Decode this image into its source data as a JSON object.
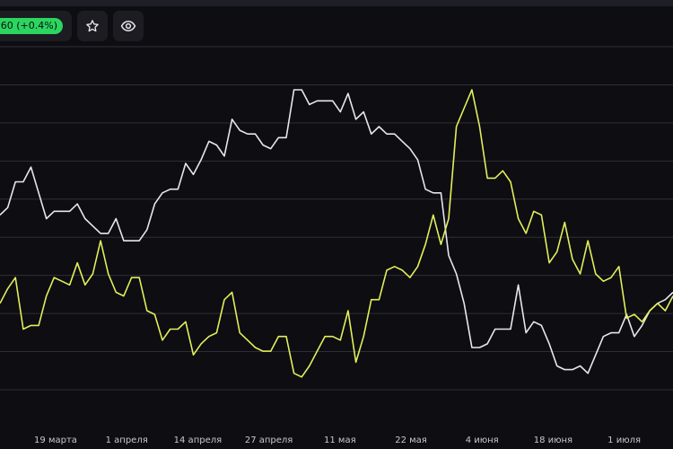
{
  "toolbar": {
    "change_label": "60 (+0.4%)",
    "favorite_icon": "star-icon",
    "watch_icon": "eye-icon"
  },
  "colors": {
    "background": "#0d0d12",
    "grid": "#2e2e36",
    "series_white": "#e6e6ec",
    "series_yellow": "#e3ee5a",
    "change_pill": "#2bd65f"
  },
  "chart_data": {
    "type": "line",
    "grid": true,
    "y_axis_labels": false,
    "x_tick_labels": [
      "19 марта",
      "1 апреля",
      "14 апреля",
      "27 апреля",
      "11 мая",
      "22 мая",
      "4 июня",
      "18 июня",
      "1 июля"
    ],
    "series": [
      {
        "color": "#e6e6ec",
        "values": [
          0.46,
          0.48,
          0.55,
          0.55,
          0.59,
          0.52,
          0.45,
          0.47,
          0.47,
          0.47,
          0.49,
          0.45,
          0.43,
          0.41,
          0.41,
          0.45,
          0.39,
          0.39,
          0.39,
          0.42,
          0.49,
          0.52,
          0.53,
          0.53,
          0.6,
          0.57,
          0.61,
          0.66,
          0.65,
          0.62,
          0.72,
          0.69,
          0.68,
          0.68,
          0.65,
          0.64,
          0.67,
          0.67,
          0.8,
          0.8,
          0.76,
          0.77,
          0.77,
          0.77,
          0.74,
          0.79,
          0.72,
          0.74,
          0.68,
          0.7,
          0.68,
          0.68,
          0.66,
          0.64,
          0.61,
          0.53,
          0.52,
          0.52,
          0.35,
          0.3,
          0.22,
          0.1,
          0.1,
          0.11,
          0.15,
          0.15,
          0.15,
          0.27,
          0.14,
          0.17,
          0.16,
          0.11,
          0.05,
          0.04,
          0.04,
          0.05,
          0.03,
          0.08,
          0.13,
          0.14,
          0.14,
          0.19,
          0.13,
          0.16,
          0.2,
          0.22,
          0.23,
          0.25
        ]
      },
      {
        "color": "#e3ee5a",
        "values": [
          0.22,
          0.26,
          0.29,
          0.15,
          0.16,
          0.16,
          0.24,
          0.29,
          0.28,
          0.27,
          0.33,
          0.27,
          0.3,
          0.39,
          0.3,
          0.25,
          0.24,
          0.29,
          0.29,
          0.2,
          0.19,
          0.12,
          0.15,
          0.15,
          0.17,
          0.08,
          0.11,
          0.13,
          0.14,
          0.23,
          0.25,
          0.14,
          0.12,
          0.1,
          0.09,
          0.09,
          0.13,
          0.13,
          0.03,
          0.02,
          0.05,
          0.09,
          0.13,
          0.13,
          0.12,
          0.2,
          0.06,
          0.13,
          0.23,
          0.23,
          0.31,
          0.32,
          0.31,
          0.29,
          0.32,
          0.38,
          0.46,
          0.38,
          0.45,
          0.7,
          0.75,
          0.8,
          0.7,
          0.56,
          0.56,
          0.58,
          0.55,
          0.45,
          0.41,
          0.47,
          0.46,
          0.33,
          0.36,
          0.44,
          0.34,
          0.3,
          0.39,
          0.3,
          0.28,
          0.29,
          0.32,
          0.18,
          0.19,
          0.17,
          0.2,
          0.22,
          0.2,
          0.24
        ]
      }
    ]
  }
}
